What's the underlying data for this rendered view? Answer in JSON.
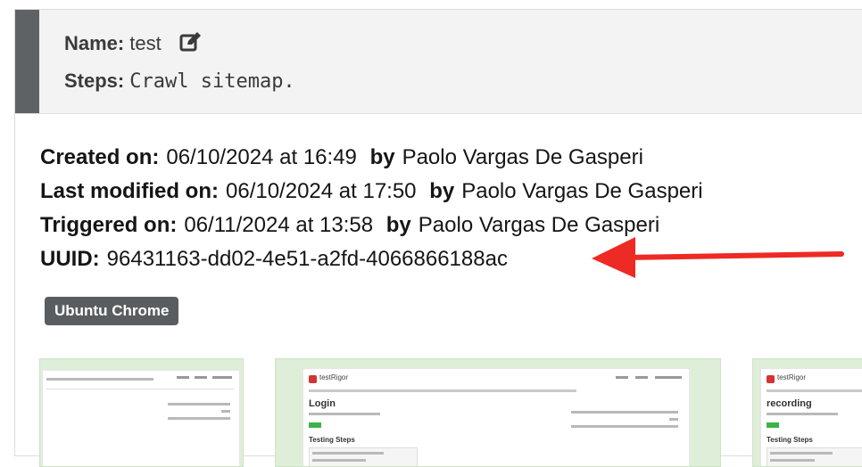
{
  "header": {
    "name_label": "Name:",
    "name_value": "test",
    "steps_label": "Steps:",
    "steps_value": "Crawl sitemap."
  },
  "meta": {
    "created_label": "Created on:",
    "created_value": "06/10/2024 at 16:49",
    "created_by_label": "by",
    "created_by": "Paolo Vargas De Gasperi",
    "modified_label": "Last modified on:",
    "modified_value": "06/10/2024 at 17:50",
    "modified_by_label": "by",
    "modified_by": "Paolo Vargas De Gasperi",
    "triggered_label": "Triggered on:",
    "triggered_value": "06/11/2024 at 13:58",
    "triggered_by_label": "by",
    "triggered_by": "Paolo Vargas De Gasperi",
    "uuid_label": "UUID:",
    "uuid_value": "96431163-dd02-4e51-a2fd-4066866188ac"
  },
  "tag": {
    "label": "Ubuntu Chrome"
  },
  "thumbnails": [
    {
      "title": "",
      "subtitle": ""
    },
    {
      "title": "Login",
      "subtitle": "Testing Steps"
    },
    {
      "title": "recording",
      "subtitle": "Testing Steps"
    }
  ],
  "colors": {
    "arrow": "#ee2a24",
    "sidebar": "#5f6265",
    "tag": "#5a5d60",
    "thumb_bg": "#dfeed9"
  },
  "icons": {
    "edit": "edit-icon"
  }
}
